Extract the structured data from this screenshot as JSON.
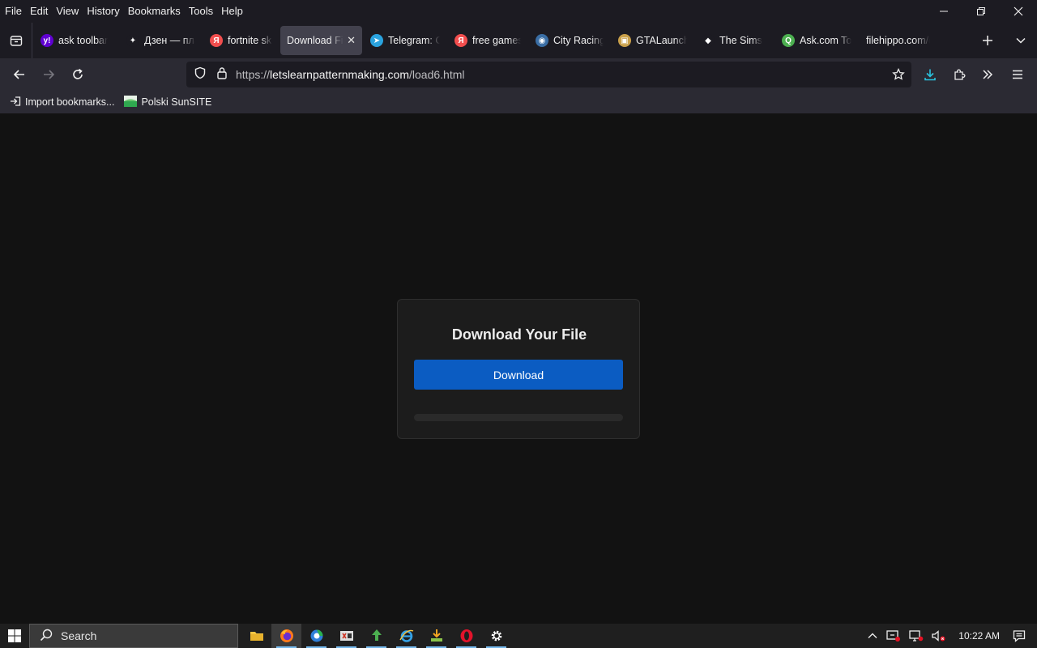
{
  "menu": [
    "File",
    "Edit",
    "View",
    "History",
    "Bookmarks",
    "Tools",
    "Help"
  ],
  "tabs": [
    {
      "title": "ask toolbar",
      "icon": "yahoo-icon",
      "color": "#6001d2",
      "glyph": "y!"
    },
    {
      "title": "Дзен — платформа",
      "icon": "dzen-icon",
      "color": "#1c1b22",
      "glyph": "✦"
    },
    {
      "title": "fortnite skins",
      "icon": "yandex-icon",
      "color": "#f24e4e",
      "glyph": "Я"
    },
    {
      "title": "Download File",
      "icon": "",
      "color": "",
      "glyph": "",
      "active": true
    },
    {
      "title": "Telegram: Contact",
      "icon": "telegram-icon",
      "color": "#2aa3df",
      "glyph": "➤"
    },
    {
      "title": "free games",
      "icon": "yandex-icon",
      "color": "#f24e4e",
      "glyph": "Я"
    },
    {
      "title": "City Racing",
      "icon": "game-icon",
      "color": "#3a6ea5",
      "glyph": "◉"
    },
    {
      "title": "GTALauncher",
      "icon": "gta-icon",
      "color": "#c9a04a",
      "glyph": "▣"
    },
    {
      "title": "The Sims",
      "icon": "sims-plumbob-icon",
      "color": "#1c1b22",
      "glyph": "◆"
    },
    {
      "title": "Ask.com Toolbar",
      "icon": "ask-icon",
      "color": "#4caf50",
      "glyph": "Q"
    },
    {
      "title": "filehippo.com/download",
      "icon": "",
      "color": "",
      "glyph": ""
    }
  ],
  "url": {
    "scheme": "https://",
    "host": "letslearnpatternmaking.com",
    "path": "/load6.html"
  },
  "bookmarks": [
    {
      "label": "Import bookmarks...",
      "icon": "import-icon"
    },
    {
      "label": "Polski SunSITE",
      "icon": "sunsite-icon"
    }
  ],
  "page": {
    "title": "Download Your File",
    "button_label": "Download",
    "progress": 0
  },
  "taskbar": {
    "search_placeholder": "Search",
    "time": "10:22 AM"
  }
}
